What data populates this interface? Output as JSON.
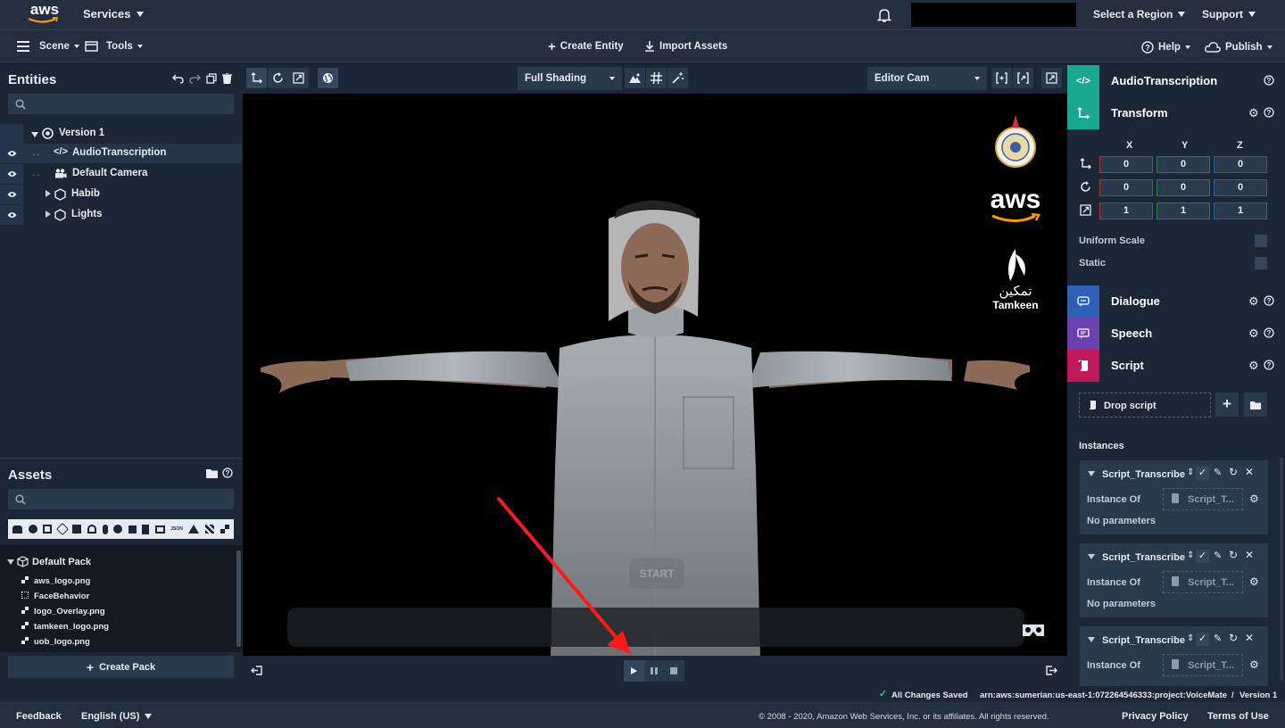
{
  "aws_nav": {
    "logo_text": "aws",
    "services_label": "Services",
    "region_label": "Select a Region",
    "support_label": "Support"
  },
  "toolbar": {
    "scene_label": "Scene",
    "tools_label": "Tools",
    "create_entity_label": "Create Entity",
    "import_assets_label": "Import Assets",
    "help_label": "Help",
    "publish_label": "Publish"
  },
  "entities": {
    "header": "Entities",
    "search_value": "",
    "tree": [
      {
        "label": "Version 1"
      },
      {
        "label": "AudioTranscription"
      },
      {
        "label": "Default Camera"
      },
      {
        "label": "Habib"
      },
      {
        "label": "Lights"
      }
    ]
  },
  "assets": {
    "header": "Assets",
    "search_value": "",
    "pack_label": "Default Pack",
    "files": [
      "aws_logo.png",
      "FaceBehavior",
      "logo_Overlay.png",
      "tamkeen_logo.png",
      "uob_logo.png"
    ],
    "create_pack_label": "Create Pack"
  },
  "viewport": {
    "shading_value": "Full Shading",
    "camera_value": "Editor Cam",
    "start_label": "START",
    "overlay_aws_text": "aws",
    "overlay_tamkeen_arabic": "تمكين",
    "overlay_tamkeen_latin": "Tamkeen"
  },
  "inspector": {
    "components": [
      {
        "label": "AudioTranscription",
        "color": "#1aa791"
      },
      {
        "label": "Transform",
        "color": "#1aa791"
      },
      {
        "label": "Dialogue",
        "color": "#2e5fb8"
      },
      {
        "label": "Speech",
        "color": "#6a3fb0"
      },
      {
        "label": "Script",
        "color": "#c0185a"
      }
    ],
    "axes": [
      "X",
      "Y",
      "Z"
    ],
    "translation": [
      "0",
      "0",
      "0"
    ],
    "rotation": [
      "0",
      "0",
      "0"
    ],
    "scale": [
      "1",
      "1",
      "1"
    ],
    "uniform_scale_label": "Uniform Scale",
    "static_label": "Static",
    "drop_script_label": "Drop script",
    "instances_label": "Instances",
    "instances": [
      {
        "title": "Script_Transcribe",
        "instance_of_label": "Instance Of",
        "instance_of_value": "Script_T...",
        "params": "No parameters"
      },
      {
        "title": "Script_Transcribe",
        "instance_of_label": "Instance Of",
        "instance_of_value": "Script_T...",
        "params": "No parameters"
      },
      {
        "title": "Script_Transcribe",
        "instance_of_label": "Instance Of",
        "instance_of_value": "Script_T...",
        "params": ""
      }
    ]
  },
  "status": {
    "saved_label": "All Changes Saved",
    "arn": "arn:aws:sumerian:us-east-1:072264546333:project:VoiceMate",
    "version": "Version 1"
  },
  "footer": {
    "feedback_label": "Feedback",
    "language_label": "English (US)",
    "copyright": "© 2008 - 2020, Amazon Web Services, Inc. or its affiliates. All rights reserved.",
    "privacy_label": "Privacy Policy",
    "terms_label": "Terms of Use"
  },
  "colors": {
    "nav_bg": "#232f3e",
    "panel_bg": "#1b2737",
    "input_bg": "#2a3a4d",
    "accent_red_arrow": "#ff1a1a",
    "saved_green": "#3ec77c"
  }
}
